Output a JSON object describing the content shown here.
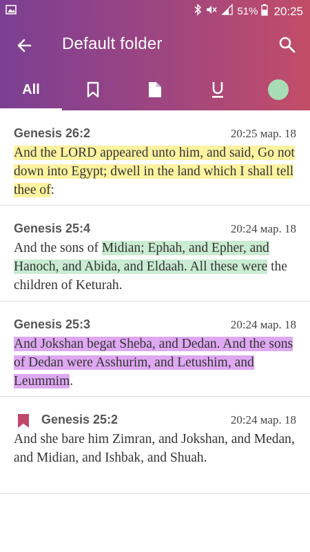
{
  "status_bar": {
    "left_icon": "image-icon",
    "battery_percent": "51%",
    "time": "20:25"
  },
  "app_bar": {
    "title": "Default folder",
    "back_icon": "arrow-left-icon",
    "search_icon": "search-icon"
  },
  "tabs": {
    "all_label": "All",
    "bookmark_icon": "bookmark-icon",
    "note_icon": "note-icon",
    "underline_icon": "underline-icon",
    "color_filter": "#a8dcb4"
  },
  "items": [
    {
      "ref": "Genesis 26:2",
      "date": "20:25 мар. 18",
      "before": "",
      "highlight": "And the LORD appeared unto him, and said, Go not down into Egypt; dwell in the land which I shall tell thee of",
      "after": ":",
      "color": "#fff3a0"
    },
    {
      "ref": "Genesis 25:4",
      "date": "20:24 мар. 18",
      "before": "And the sons of ",
      "highlight": "Midian; Ephah, and Epher, and Hanoch, and Abida, and Eldaah. All these were",
      "after": " the children of Keturah.",
      "color": "#c9ecd2"
    },
    {
      "ref": "Genesis 25:3",
      "date": "20:24 мар. 18",
      "before": "",
      "highlight": "And Jokshan begat Sheba, and Dedan. And the sons of Dedan were Asshurim, and Letushim, and Leummim",
      "after": ".",
      "color": "#dfa8f2"
    },
    {
      "ref": "Genesis 25:2",
      "date": "20:24 мар. 18",
      "text": "And she bare him Zimran, and Jokshan, and Medan, and Midian, and Ishbak, and Shuah.",
      "bookmark_color": "#c0466a"
    }
  ]
}
